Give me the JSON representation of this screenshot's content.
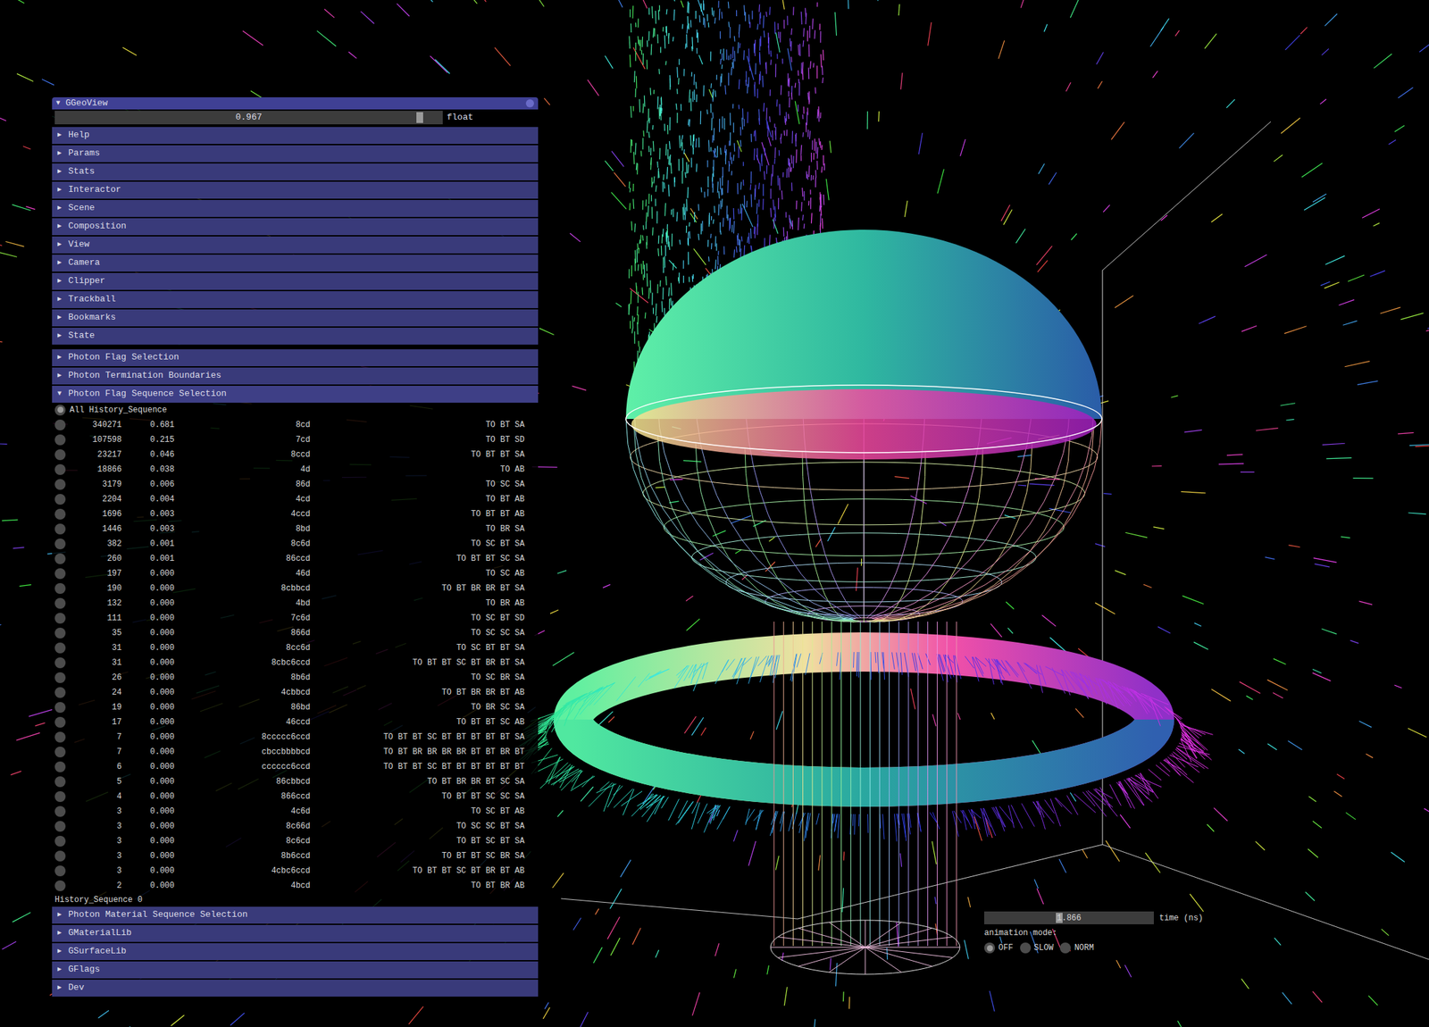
{
  "panel": {
    "title": "GGeoView",
    "arrow": "▼",
    "slider": {
      "value": "0.967",
      "label": "float",
      "level": 0.955
    }
  },
  "sections_top": [
    {
      "label": "Help",
      "arrow": "▶",
      "expanded": false
    },
    {
      "label": "Params",
      "arrow": "▶",
      "expanded": false
    },
    {
      "label": "Stats",
      "arrow": "▶",
      "expanded": false
    },
    {
      "label": "Interactor",
      "arrow": "▶",
      "expanded": false
    },
    {
      "label": "Scene",
      "arrow": "▶",
      "expanded": false
    },
    {
      "label": "Composition",
      "arrow": "▶",
      "expanded": false
    },
    {
      "label": "View",
      "arrow": "▶",
      "expanded": false
    },
    {
      "label": "Camera",
      "arrow": "▶",
      "expanded": false
    },
    {
      "label": "Clipper",
      "arrow": "▶",
      "expanded": false
    },
    {
      "label": "Trackball",
      "arrow": "▶",
      "expanded": false
    },
    {
      "label": "Bookmarks",
      "arrow": "▶",
      "expanded": false
    },
    {
      "label": "State",
      "arrow": "▶",
      "expanded": false
    }
  ],
  "sections_photon": [
    {
      "label": "Photon Flag Selection",
      "arrow": "▶",
      "expanded": false
    },
    {
      "label": "Photon Termination Boundaries",
      "arrow": "▶",
      "expanded": false
    },
    {
      "label": "Photon Flag Sequence Selection",
      "arrow": "▼",
      "expanded": true
    }
  ],
  "sequence_selection": {
    "all": {
      "label": "All History_Sequence",
      "selected": true
    },
    "rows": [
      {
        "count": "340271",
        "frac": "0.681",
        "hex": "8cd",
        "seq": "TO BT SA",
        "selected": false
      },
      {
        "count": "107598",
        "frac": "0.215",
        "hex": "7cd",
        "seq": "TO BT SD",
        "selected": false
      },
      {
        "count": "23217",
        "frac": "0.046",
        "hex": "8ccd",
        "seq": "TO BT BT SA",
        "selected": false
      },
      {
        "count": "18866",
        "frac": "0.038",
        "hex": "4d",
        "seq": "TO AB",
        "selected": false
      },
      {
        "count": "3179",
        "frac": "0.006",
        "hex": "86d",
        "seq": "TO SC SA",
        "selected": false
      },
      {
        "count": "2204",
        "frac": "0.004",
        "hex": "4cd",
        "seq": "TO BT AB",
        "selected": false
      },
      {
        "count": "1696",
        "frac": "0.003",
        "hex": "4ccd",
        "seq": "TO BT BT AB",
        "selected": false
      },
      {
        "count": "1446",
        "frac": "0.003",
        "hex": "8bd",
        "seq": "TO BR SA",
        "selected": false
      },
      {
        "count": "382",
        "frac": "0.001",
        "hex": "8c6d",
        "seq": "TO SC BT SA",
        "selected": false
      },
      {
        "count": "260",
        "frac": "0.001",
        "hex": "86ccd",
        "seq": "TO BT BT SC SA",
        "selected": false
      },
      {
        "count": "197",
        "frac": "0.000",
        "hex": "46d",
        "seq": "TO SC AB",
        "selected": false
      },
      {
        "count": "190",
        "frac": "0.000",
        "hex": "8cbbcd",
        "seq": "TO BT BR BR BT SA",
        "selected": false
      },
      {
        "count": "132",
        "frac": "0.000",
        "hex": "4bd",
        "seq": "TO BR AB",
        "selected": false
      },
      {
        "count": "111",
        "frac": "0.000",
        "hex": "7c6d",
        "seq": "TO SC BT SD",
        "selected": false
      },
      {
        "count": "35",
        "frac": "0.000",
        "hex": "866d",
        "seq": "TO SC SC SA",
        "selected": false
      },
      {
        "count": "31",
        "frac": "0.000",
        "hex": "8cc6d",
        "seq": "TO SC BT BT SA",
        "selected": false
      },
      {
        "count": "31",
        "frac": "0.000",
        "hex": "8cbc6ccd",
        "seq": "TO BT BT SC BT BR BT SA",
        "selected": false
      },
      {
        "count": "26",
        "frac": "0.000",
        "hex": "8b6d",
        "seq": "TO SC BR SA",
        "selected": false
      },
      {
        "count": "24",
        "frac": "0.000",
        "hex": "4cbbcd",
        "seq": "TO BT BR BR BT AB",
        "selected": false
      },
      {
        "count": "19",
        "frac": "0.000",
        "hex": "86bd",
        "seq": "TO BR SC SA",
        "selected": false
      },
      {
        "count": "17",
        "frac": "0.000",
        "hex": "46ccd",
        "seq": "TO BT BT SC AB",
        "selected": false
      },
      {
        "count": "7",
        "frac": "0.000",
        "hex": "8ccccc6ccd",
        "seq": "TO BT BT SC BT BT BT BT BT SA",
        "selected": false
      },
      {
        "count": "7",
        "frac": "0.000",
        "hex": "cbccbbbbcd",
        "seq": "TO BT BR BR BR BR BT BT BR BT",
        "selected": false
      },
      {
        "count": "6",
        "frac": "0.000",
        "hex": "cccccc6ccd",
        "seq": "TO BT BT SC BT BT BT BT BT BT",
        "selected": false
      },
      {
        "count": "5",
        "frac": "0.000",
        "hex": "86cbbcd",
        "seq": "TO BT BR BR BT SC SA",
        "selected": false
      },
      {
        "count": "4",
        "frac": "0.000",
        "hex": "866ccd",
        "seq": "TO BT BT SC SC SA",
        "selected": false
      },
      {
        "count": "3",
        "frac": "0.000",
        "hex": "4c6d",
        "seq": "TO SC BT AB",
        "selected": false
      },
      {
        "count": "3",
        "frac": "0.000",
        "hex": "8c66d",
        "seq": "TO SC SC BT SA",
        "selected": false
      },
      {
        "count": "3",
        "frac": "0.000",
        "hex": "8c6cd",
        "seq": "TO BT SC BT SA",
        "selected": false
      },
      {
        "count": "3",
        "frac": "0.000",
        "hex": "8b6ccd",
        "seq": "TO BT BT SC BR SA",
        "selected": false
      },
      {
        "count": "3",
        "frac": "0.000",
        "hex": "4cbc6ccd",
        "seq": "TO BT BT SC BT BR BT AB",
        "selected": false
      },
      {
        "count": "2",
        "frac": "0.000",
        "hex": "4bcd",
        "seq": "TO BT BR AB",
        "selected": false
      }
    ],
    "footer": "History_Sequence 0"
  },
  "sections_bottom": [
    {
      "label": "Photon Material Sequence Selection",
      "arrow": "▶",
      "expanded": false
    },
    {
      "label": "GMaterialLib",
      "arrow": "▶",
      "expanded": false
    },
    {
      "label": "GSurfaceLib",
      "arrow": "▶",
      "expanded": false
    },
    {
      "label": "GFlags",
      "arrow": "▶",
      "expanded": false
    },
    {
      "label": "Dev",
      "arrow": "▶",
      "expanded": false
    }
  ],
  "time_control": {
    "value": "1.866",
    "label": "time (ns)",
    "level": 0.44,
    "mode_label": "animation mode:",
    "modes": [
      {
        "label": "OFF",
        "selected": true
      },
      {
        "label": "SLOW",
        "selected": false
      },
      {
        "label": "NORM",
        "selected": false
      }
    ]
  }
}
